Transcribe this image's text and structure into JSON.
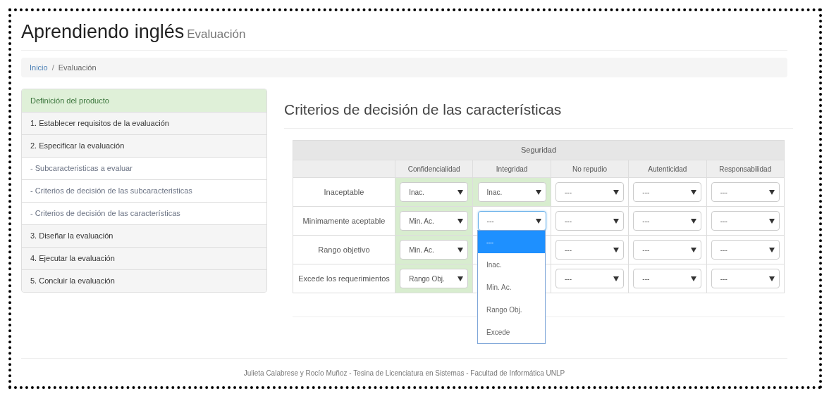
{
  "header": {
    "title": "Aprendiendo inglés",
    "subtitle": "Evaluación"
  },
  "breadcrumb": {
    "separator": "/",
    "items": [
      {
        "label": "Inicio",
        "link": true
      },
      {
        "label": "Evaluación",
        "link": false
      }
    ]
  },
  "sidebar": {
    "items": [
      {
        "kind": "header",
        "label": "Definición del producto"
      },
      {
        "kind": "step",
        "label": "1. Establecer requisitos de la evaluación"
      },
      {
        "kind": "step",
        "label": "2. Especificar la evaluación"
      },
      {
        "kind": "sub",
        "label": "- Subcaracteristicas a evaluar"
      },
      {
        "kind": "sub",
        "label": "- Criterios de decisión de las subcaracteristicas"
      },
      {
        "kind": "sub",
        "label": "- Criterios de decisión de las características"
      },
      {
        "kind": "step",
        "label": "3. Diseñar la evaluación"
      },
      {
        "kind": "step",
        "label": "4. Ejecutar la evaluación"
      },
      {
        "kind": "step",
        "label": "5. Concluir la evaluación"
      }
    ]
  },
  "main": {
    "heading": "Criterios de decisión de las características",
    "table": {
      "group": "Seguridad",
      "columns": [
        "Confidencialidad",
        "Integridad",
        "No repudio",
        "Autenticidad",
        "Responsabilidad"
      ],
      "rows": [
        {
          "label": "Inaceptable",
          "cells": [
            {
              "value": "Inac.",
              "highlighted": true,
              "focused": false
            },
            {
              "value": "Inac.",
              "highlighted": true,
              "focused": false
            },
            {
              "value": "---",
              "highlighted": false,
              "focused": false
            },
            {
              "value": "---",
              "highlighted": false,
              "focused": false
            },
            {
              "value": "---",
              "highlighted": false,
              "focused": false
            }
          ]
        },
        {
          "label": "Minimamente aceptable",
          "cells": [
            {
              "value": "Min. Ac.",
              "highlighted": true,
              "focused": false
            },
            {
              "value": "---",
              "highlighted": false,
              "focused": true
            },
            {
              "value": "---",
              "highlighted": false,
              "focused": false
            },
            {
              "value": "---",
              "highlighted": false,
              "focused": false
            },
            {
              "value": "---",
              "highlighted": false,
              "focused": false
            }
          ]
        },
        {
          "label": "Rango objetivo",
          "cells": [
            {
              "value": "Min. Ac.",
              "highlighted": true,
              "focused": false
            },
            null,
            {
              "value": "---",
              "highlighted": false,
              "focused": false
            },
            {
              "value": "---",
              "highlighted": false,
              "focused": false
            },
            {
              "value": "---",
              "highlighted": false,
              "focused": false
            }
          ]
        },
        {
          "label": "Excede los requerimientos",
          "cells": [
            {
              "value": "Rango Obj.",
              "highlighted": true,
              "focused": false
            },
            null,
            {
              "value": "---",
              "highlighted": false,
              "focused": false
            },
            {
              "value": "---",
              "highlighted": false,
              "focused": false
            },
            {
              "value": "---",
              "highlighted": false,
              "focused": false
            }
          ]
        }
      ],
      "dropdown": {
        "options": [
          {
            "label": "---",
            "selected": true
          },
          {
            "label": "Inac.",
            "selected": false
          },
          {
            "label": "Min. Ac.",
            "selected": false
          },
          {
            "label": "Rango Obj.",
            "selected": false
          },
          {
            "label": "Excede",
            "selected": false
          }
        ]
      }
    }
  },
  "footer": "Julieta Calabrese y Rocío Muñoz - Tesina de Licenciatura en Sistemas - Facultad de Informática UNLP"
}
